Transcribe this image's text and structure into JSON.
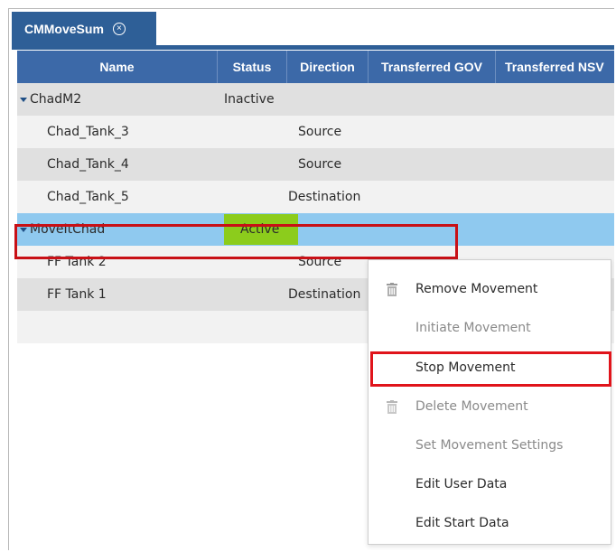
{
  "tab": {
    "title": "CMMoveSum",
    "close_glyph": "×"
  },
  "columns": [
    "Name",
    "Status",
    "Direction",
    "Transferred GOV",
    "Transferred NSV"
  ],
  "rows": [
    {
      "name": "ChadM2",
      "status": "Inactive",
      "direction": ""
    },
    {
      "name": "Chad_Tank_3",
      "status": "",
      "direction": "Source"
    },
    {
      "name": "Chad_Tank_4",
      "status": "",
      "direction": "Source"
    },
    {
      "name": "Chad_Tank_5",
      "status": "",
      "direction": "Destination"
    },
    {
      "name": "MoveItChad",
      "status": "Active",
      "direction": ""
    },
    {
      "name": "FF Tank 2",
      "status": "",
      "direction": "Source"
    },
    {
      "name": "FF Tank 1",
      "status": "",
      "direction": "Destination"
    }
  ],
  "context_menu": {
    "items": [
      {
        "label": "Remove Movement",
        "enabled": true,
        "icon": "trash-icon"
      },
      {
        "label": "Initiate Movement",
        "enabled": false
      },
      {
        "label": "Stop Movement",
        "enabled": true
      },
      {
        "label": "Delete Movement",
        "enabled": false,
        "icon": "trash-icon"
      },
      {
        "label": "Set Movement Settings",
        "enabled": false
      },
      {
        "label": "Edit User Data",
        "enabled": true
      },
      {
        "label": "Edit Start Data",
        "enabled": true
      }
    ]
  },
  "colors": {
    "tab_blue": "#2e5f97",
    "header_blue": "#3c69a8",
    "selected_row": "#8fc9ef",
    "active_green": "#8ccc1c",
    "highlight_red": "#e0141b"
  }
}
